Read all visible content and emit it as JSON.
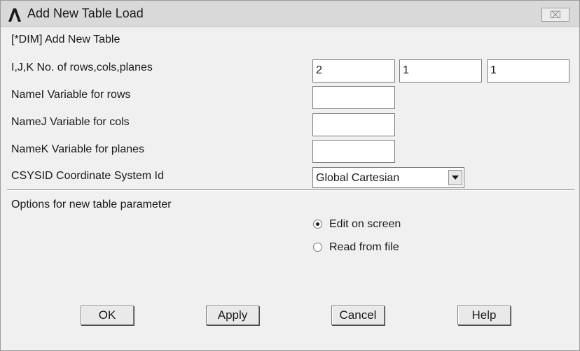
{
  "window": {
    "title": "Add New Table Load",
    "close_glyph": "⌧"
  },
  "header": {
    "command": "[*DIM] Add New Table"
  },
  "fields": {
    "ijk": {
      "label": "I,J,K  No. of rows,cols,planes",
      "values": [
        "2",
        "1",
        "1"
      ]
    },
    "name_i": {
      "label": "NameI  Variable for rows",
      "value": ""
    },
    "name_j": {
      "label": "NameJ  Variable for cols",
      "value": ""
    },
    "name_k": {
      "label": "NameK  Variable for planes",
      "value": ""
    },
    "csysid": {
      "label": "CSYSID  Coordinate System Id",
      "selected": "Global Cartesian"
    }
  },
  "options": {
    "label": "Options for new table parameter",
    "radios": [
      {
        "label": "Edit on screen",
        "checked": true
      },
      {
        "label": "Read from file",
        "checked": false
      }
    ]
  },
  "buttons": {
    "ok": "OK",
    "apply": "Apply",
    "cancel": "Cancel",
    "help": "Help"
  }
}
